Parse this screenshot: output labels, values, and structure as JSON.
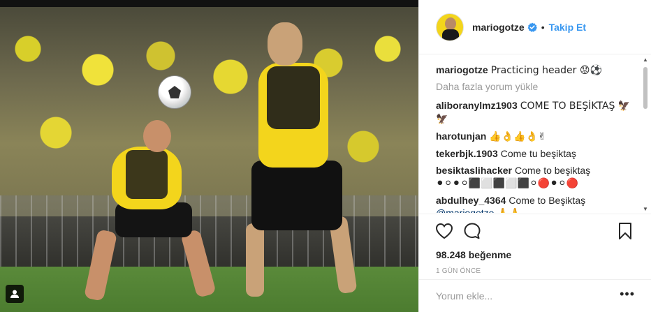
{
  "post": {
    "username": "mariogotze",
    "follow_label": "Takip Et",
    "separator": "•",
    "caption_user": "mariogotze",
    "caption_text": "Practicing header 😟⚽",
    "load_more": "Daha fazla yorum yükle",
    "likes": "98.248 beğenme",
    "time": "1 GÜN ÖNCE",
    "comment_placeholder": "Yorum ekle...",
    "more_label": "•••"
  },
  "comments": [
    {
      "user": "aliboranylmz1903",
      "text": "COME TO BEŞİKTAŞ 🦅🦅"
    },
    {
      "user": "harotunjan",
      "text": "👍👌👍👌✌"
    },
    {
      "user": "tekerbjk.1903",
      "text": "Come tu beşiktaş"
    },
    {
      "user": "besiktaslihacker",
      "text": "Come to beşiktaş",
      "extra": "⚫⚪⚫⚪⬛⬜⬛⬜⬛⚪🔴⚫⚪🔴"
    },
    {
      "user": "abdulhey_4364",
      "text": "Come to Beşiktaş",
      "mention": "@mariogotze",
      "extra": "🙏🙏"
    }
  ],
  "colors": {
    "accent": "#3897f0",
    "verified": "#3897f0",
    "jersey": "#f3d51c"
  },
  "icons": {
    "like": "heart-icon",
    "comment": "comment-icon",
    "save": "bookmark-icon",
    "verified": "verified-badge-icon",
    "tag": "user-tag-icon"
  }
}
